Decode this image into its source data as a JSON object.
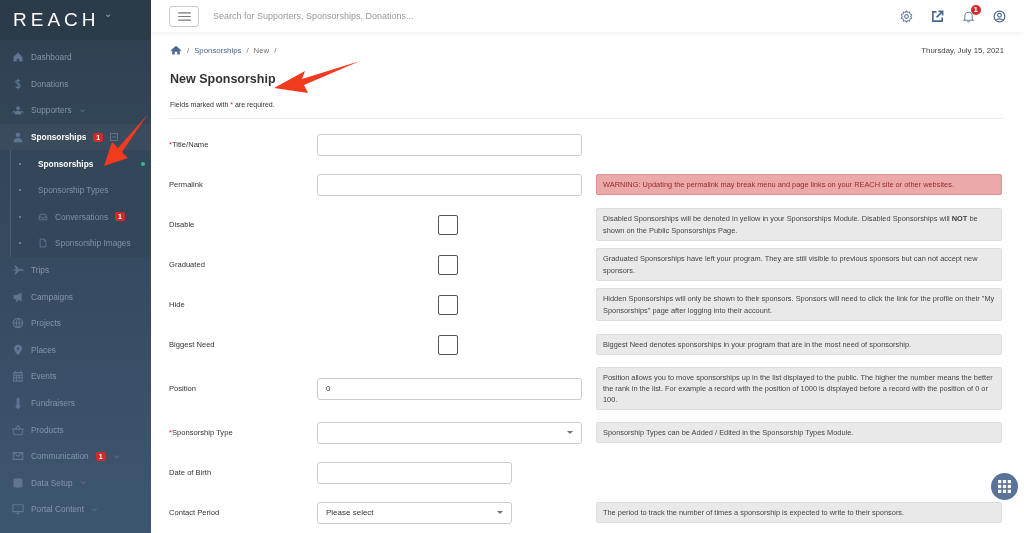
{
  "logo": {
    "text": "REACH",
    "caret": "⌄"
  },
  "sidebar": {
    "items": [
      {
        "label": "Dashboard",
        "selected": false
      },
      {
        "label": "Donations",
        "selected": false
      },
      {
        "label": "Supporters",
        "selected": false,
        "has_caret": true
      },
      {
        "label": "Sponsorships",
        "selected": true,
        "badge": "1",
        "expanded": true,
        "children": [
          {
            "label": "Sponsorships",
            "selected": true
          },
          {
            "label": "Sponsorship Types",
            "selected": false
          },
          {
            "label": "Conversations",
            "selected": false,
            "badge": "1"
          },
          {
            "label": "Sponsorship Images",
            "selected": false
          }
        ]
      },
      {
        "label": "Trips",
        "selected": false
      },
      {
        "label": "Campaigns",
        "selected": false
      },
      {
        "label": "Projects",
        "selected": false
      },
      {
        "label": "Places",
        "selected": false
      },
      {
        "label": "Events",
        "selected": false
      },
      {
        "label": "Fundraisers",
        "selected": false
      },
      {
        "label": "Products",
        "selected": false
      },
      {
        "label": "Communication",
        "selected": false,
        "badge": "1",
        "has_caret": true
      },
      {
        "label": "Data Setup",
        "selected": false,
        "has_caret": true
      },
      {
        "label": "Portal Content",
        "selected": false,
        "has_caret": true
      }
    ]
  },
  "topbar": {
    "search": {
      "placeholder": "Search for Supporters, Sponsorships, Donations..."
    },
    "notification_badge": "1"
  },
  "breadcrumb": {
    "separator": "/",
    "items": [
      "Sponsorships",
      "New"
    ],
    "date": "Thursday, July 15, 2021"
  },
  "page": {
    "title": "New Sponsorship",
    "note": {
      "before": "Fields marked with",
      "mark": "*",
      "after": "are required."
    }
  },
  "form": {
    "rows": [
      {
        "label": "Title/Name",
        "required": true,
        "field": {
          "kind": "text"
        }
      },
      {
        "label": "Permalink",
        "required": false,
        "field": {
          "kind": "text"
        },
        "help": {
          "kind": "warning",
          "text": "WARNING: Updating the permalink may break menu and page links on your REACH site or other websites."
        }
      },
      {
        "label": "Disable",
        "required": false,
        "field": {
          "kind": "checkbox",
          "checked": false
        },
        "help": {
          "kind": "info",
          "text": "Disabled Sponsorships will be denoted in yellow in your Sponsorships Module. Disabled Sponsorships will **NOT** be shown on the Public Sponsorships Page."
        }
      },
      {
        "label": "Graduated",
        "required": false,
        "field": {
          "kind": "checkbox",
          "checked": false
        },
        "help": {
          "kind": "info",
          "text": "Graduated Sponsorships have left your program. They are still visible to previous sponsors but can not accept new sponsors."
        }
      },
      {
        "label": "Hide",
        "required": false,
        "field": {
          "kind": "checkbox",
          "checked": false
        },
        "help": {
          "kind": "info",
          "text": "Hidden Sponsorships will only be shown to their sponsors. Sponsors will need to click the link for the profile on their \"My Sponsorships\" page after logging into their account."
        }
      },
      {
        "label": "Biggest Need",
        "required": false,
        "field": {
          "kind": "checkbox",
          "checked": false
        },
        "help": {
          "kind": "info",
          "text": "Biggest Need denotes sponsorships in your program that are in the most need of sponsorship."
        }
      },
      {
        "label": "Position",
        "required": false,
        "field": {
          "kind": "text",
          "value": "0"
        },
        "help": {
          "kind": "info",
          "text": "Position allows you to move sponsorships up in the list displayed to the public. The higher the number means the better the rank in the list. For example a record with the position of 1000 is displayed before a record with the position of 0 or 100."
        }
      },
      {
        "label": "Sponsorship Type",
        "required": true,
        "field": {
          "kind": "select"
        },
        "help": {
          "kind": "info",
          "text": "Sponsorship Types can be Added / Edited in the Sponsorship Types Module."
        }
      },
      {
        "label": "Date of Birth",
        "required": false,
        "field": {
          "kind": "date"
        }
      },
      {
        "label": "Contact Period",
        "required": false,
        "field": {
          "kind": "small_select",
          "value": "Please select"
        },
        "help": {
          "kind": "info",
          "text": "The period to track the number of times a sponsorship is expected to write to their sponsors."
        }
      }
    ]
  }
}
